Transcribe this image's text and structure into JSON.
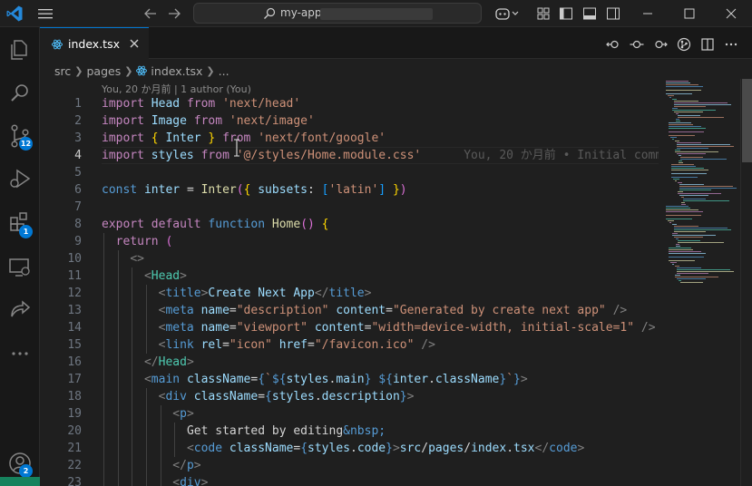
{
  "titlebar": {
    "search_text": "my-app"
  },
  "activity_badges": {
    "source_control": "12",
    "extensions": "1",
    "accounts": "2"
  },
  "tab": {
    "label": "index.tsx"
  },
  "breadcrumb": {
    "items": [
      "src",
      "pages",
      "index.tsx",
      "..."
    ]
  },
  "editor": {
    "blame_header": "You, 20 か月前 | 1 author (You)",
    "inline_blame": "You, 20 か月前 • Initial comm",
    "active_line": 4,
    "line_numbers": [
      "1",
      "2",
      "3",
      "4",
      "5",
      "6",
      "7",
      "8",
      "9",
      "10",
      "11",
      "12",
      "13",
      "14",
      "15",
      "16",
      "17",
      "18",
      "19",
      "20",
      "21",
      "22",
      "23"
    ],
    "lines": [
      "import Head from 'next/head'",
      "import Image from 'next/image'",
      "import { Inter } from 'next/font/google'",
      "import styles from '@/styles/Home.module.css'",
      "",
      "const inter = Inter({ subsets: ['latin'] })",
      "",
      "export default function Home() {",
      "  return (",
      "    <>",
      "      <Head>",
      "        <title>Create Next App</title>",
      "        <meta name=\"description\" content=\"Generated by create next app\" />",
      "        <meta name=\"viewport\" content=\"width=device-width, initial-scale=1\" />",
      "        <link rel=\"icon\" href=\"/favicon.ico\" />",
      "      </Head>",
      "      <main className={`${styles.main} ${inter.className}`}>",
      "        <div className={styles.description}>",
      "          <p>",
      "            Get started by editing&nbsp;",
      "            <code className={styles.code}>src/pages/index.tsx</code>",
      "          </p>",
      "          <div>"
    ]
  },
  "colors": {
    "accent": "#0078d4",
    "badge": "#0078d4",
    "status_remote": "#16825d",
    "keyword": "#c586c0",
    "string": "#ce9178",
    "variable": "#9cdcfe",
    "function": "#dcdcaa",
    "tag": "#4ec9b0"
  },
  "icons": {
    "app_logo": "vscode-logo-icon",
    "explorer": "files-icon",
    "search": "search-icon",
    "source_control": "source-control-icon",
    "run_debug": "run-debug-icon",
    "extensions": "extensions-icon",
    "remote_explorer": "remote-explorer-icon",
    "live_share": "live-share-icon",
    "more": "ellipsis-icon",
    "accounts": "account-icon"
  }
}
